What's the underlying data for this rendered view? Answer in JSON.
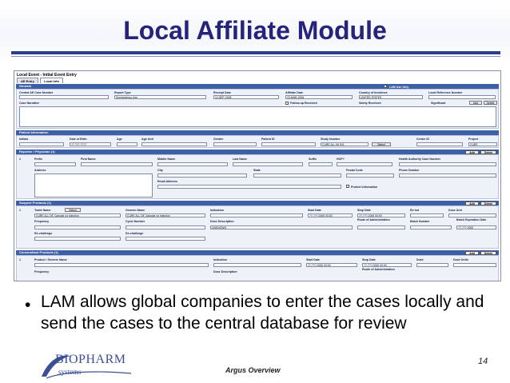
{
  "slide": {
    "title": "Local Affiliate Module",
    "bullet": "LAM allows global companies to enter the cases locally and send the cases to the central database for review",
    "footer": "Argus Overview",
    "page_number": "14",
    "logo_text": "BIOPHARM",
    "logo_sub": "systems"
  },
  "app": {
    "window_title": "Local Event - Initial Event Entry",
    "tabs": [
      "AE Entry",
      "Local Info"
    ],
    "general": {
      "header": "General",
      "lam_use_only": "LAM Use Only",
      "columns": [
        "Central AE Case Number",
        "Report Type",
        "Receipt Date",
        "Affiliate Date",
        "Country of Incidence",
        "Local Reference Number"
      ],
      "report_type": "Spontaneous Use",
      "receipt_date": "12-SEP-2005",
      "affiliate_date": "23-MAR-2006",
      "country": "UNITED STATES",
      "case_narrative": "Case Narrative",
      "follow_up": "Follow-up Received",
      "safety_received": "Safety Received",
      "significant": "Significant",
      "add": "Add",
      "delete": "Delete"
    },
    "patient": {
      "header": "Patient Information",
      "columns": [
        "Initials",
        "Date of Birth",
        "Age",
        "Age Unit",
        "Gender",
        "Patient ID",
        "Study Number",
        "Center ID",
        "Project"
      ],
      "dob": "?? ??? ????",
      "study": "CURE ALL IM 001",
      "select": "Select",
      "project": "CURE"
    },
    "reporter": {
      "header": "Reporter / Physician  (1)",
      "columns": [
        "Prefix",
        "First Name",
        "Middle Name",
        "Last Name",
        "Suffix",
        "HCP?",
        "Health Authority Case Number"
      ],
      "columns2": [
        "Address",
        "City",
        "State",
        "Postal Code",
        "Phone Number"
      ],
      "email": "Email Address",
      "protect": "Protect Information",
      "add": "Add",
      "delete": "Delete"
    },
    "suspect": {
      "header": "Suspect Products  (1)",
      "columns": [
        "Trade Name",
        "Select",
        "Generic Name",
        "Indication",
        "Start Date",
        "Stop Date",
        "Rx Ind",
        "Dose Unit"
      ],
      "trade_name": "CURE ALL DE Capsule no Injection",
      "generic": "CURE ALL DE Capsule no Injection",
      "start": "??-???-0000 00:00",
      "stop": "??-???-0000 00:00",
      "columns2": [
        "Frequency",
        "Cycle Number",
        "Dose Description",
        "Route of Administration",
        "Batch Number",
        "Batch Expiration Date"
      ],
      "dose_desc": "UNKNOWN",
      "batch_exp": "??-???-0000",
      "rechallenge": "Re-challenge",
      "dechallenge": "De-challenge",
      "add": "Add",
      "delete": "Delete"
    },
    "concomitant": {
      "header": "Concomitant Products  (1)",
      "columns": [
        "Product / Generic Name",
        "Indication",
        "Start Date",
        "Stop Date",
        "Dose",
        "Dose Units"
      ],
      "start": "??-???-0000 00:00",
      "stop": "??-???-0000 00:00",
      "columns2": [
        "Frequency",
        "Dose Description",
        "Route of Administration"
      ],
      "add": "Add",
      "delete": "Delete"
    }
  }
}
